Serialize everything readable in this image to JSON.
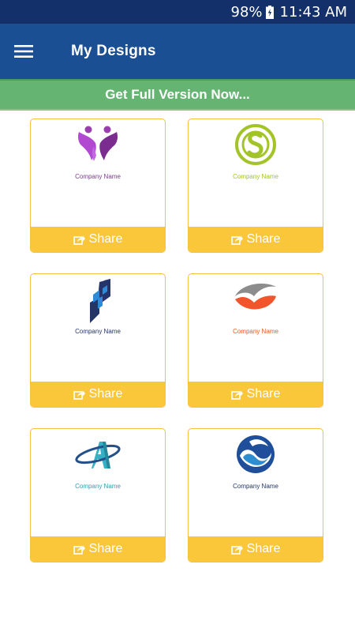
{
  "status_bar": {
    "battery": "98%",
    "time": "11:43 AM"
  },
  "app_bar": {
    "title": "My Designs",
    "menu_icon": "hamburger-menu-icon"
  },
  "promo": {
    "label": "Get Full Version Now..."
  },
  "designs": [
    {
      "company": "Company Name",
      "company_color": "#7b3d8f",
      "share_label": "Share",
      "logo_icon": "butterfly-people-logo-icon"
    },
    {
      "company": "Company Name",
      "company_color": "#a3c429",
      "share_label": "Share",
      "logo_icon": "green-s-circle-logo-icon"
    },
    {
      "company": "Company Name",
      "company_color": "#24356a",
      "share_label": "Share",
      "logo_icon": "blue-arrow-logo-icon"
    },
    {
      "company": "Company Name",
      "company_color": "#f2552c",
      "share_label": "Share",
      "logo_icon": "gray-orange-swoosh-logo-icon"
    },
    {
      "company": "Company Name",
      "company_color": "#2f9fb3",
      "share_label": "Share",
      "logo_icon": "teal-a-orbit-logo-icon"
    },
    {
      "company": "Company Name",
      "company_color": "#24356a",
      "share_label": "Share",
      "logo_icon": "blue-wave-circle-logo-icon"
    }
  ],
  "colors": {
    "status_bar": "#13306a",
    "app_bar": "#1b4f93",
    "promo": "#66b472",
    "share": "#fbc73a",
    "card_border": "#f3c23f"
  }
}
